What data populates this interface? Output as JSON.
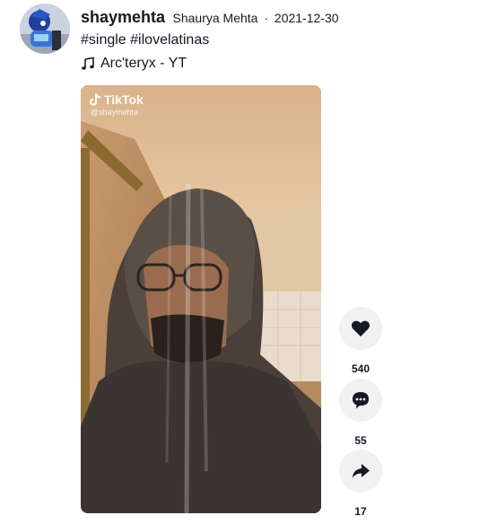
{
  "post": {
    "username": "shaymehta",
    "display_name": "Shaurya Mehta",
    "separator": "·",
    "date": "2021-12-30",
    "hashtags": [
      "#single",
      "#ilovelatinas"
    ],
    "music": {
      "icon": "music-note-icon",
      "title": "Arc'teryx - YT"
    },
    "video": {
      "watermark_logo": "TikTok",
      "watermark_user": "@shaymehta"
    },
    "actions": {
      "likes": {
        "icon": "heart-icon",
        "count": "540"
      },
      "comments": {
        "icon": "comment-icon",
        "count": "55"
      },
      "shares": {
        "icon": "share-icon",
        "count": "17"
      }
    }
  },
  "colors": {
    "text": "#161823",
    "action_bg": "#f1f1f2",
    "white": "#ffffff"
  }
}
